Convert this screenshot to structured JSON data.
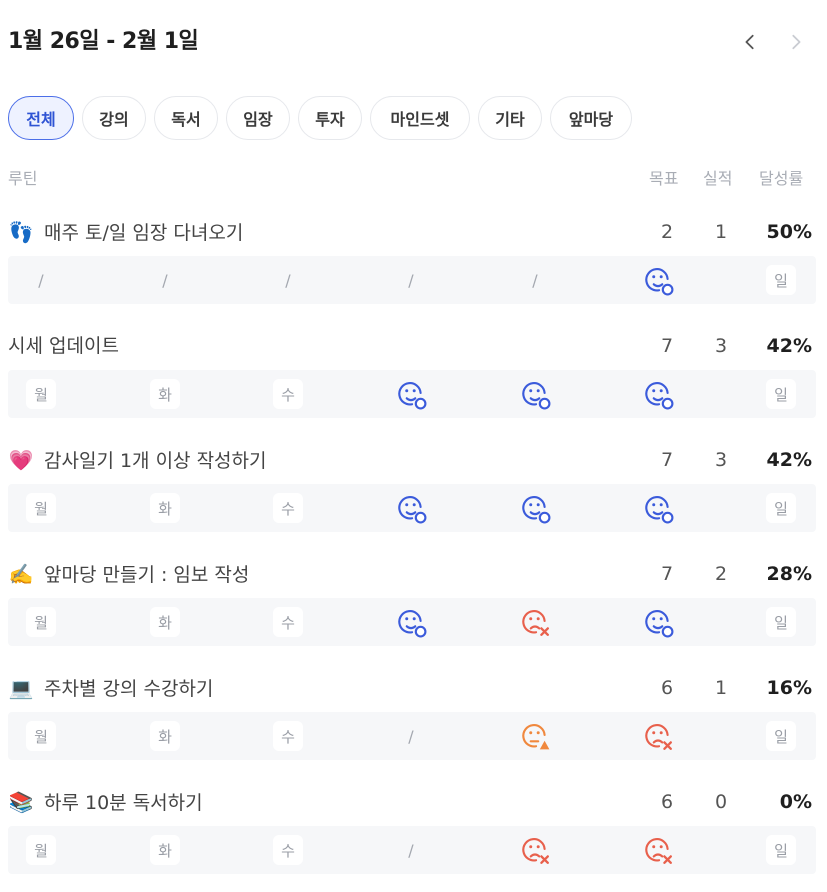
{
  "header": {
    "title": "1월 26일 - 2월 1일"
  },
  "categories": [
    {
      "label": "전체",
      "active": true
    },
    {
      "label": "강의",
      "active": false
    },
    {
      "label": "독서",
      "active": false
    },
    {
      "label": "임장",
      "active": false
    },
    {
      "label": "투자",
      "active": false
    },
    {
      "label": "마인드셋",
      "active": false
    },
    {
      "label": "기타",
      "active": false
    },
    {
      "label": "앞마당",
      "active": false
    }
  ],
  "columns": {
    "routine": "루틴",
    "goal": "목표",
    "actual": "실적",
    "rate": "달성률"
  },
  "colors": {
    "success": "#3b5bdb",
    "fail": "#e8604c",
    "warning": "#f0883e",
    "accent": "#2f54d4"
  },
  "routines": [
    {
      "emoji": "👣",
      "name": "매주 토/일 임장 다녀오기",
      "goal": "2",
      "actual": "1",
      "rate": "50%",
      "days": [
        {
          "type": "slash",
          "text": "/"
        },
        {
          "type": "slash",
          "text": "/"
        },
        {
          "type": "slash",
          "text": "/"
        },
        {
          "type": "slash",
          "text": "/"
        },
        {
          "type": "slash",
          "text": "/"
        },
        {
          "type": "success",
          "icon": "smile-check-icon"
        },
        {
          "type": "label",
          "text": "일"
        }
      ]
    },
    {
      "emoji": "",
      "name": "시세 업데이트",
      "goal": "7",
      "actual": "3",
      "rate": "42%",
      "days": [
        {
          "type": "label",
          "text": "월"
        },
        {
          "type": "label",
          "text": "화"
        },
        {
          "type": "label",
          "text": "수"
        },
        {
          "type": "success",
          "icon": "smile-check-icon"
        },
        {
          "type": "success",
          "icon": "smile-check-icon"
        },
        {
          "type": "success",
          "icon": "smile-check-icon"
        },
        {
          "type": "label",
          "text": "일"
        }
      ]
    },
    {
      "emoji": "💗",
      "name": "감사일기 1개 이상 작성하기",
      "goal": "7",
      "actual": "3",
      "rate": "42%",
      "days": [
        {
          "type": "label",
          "text": "월"
        },
        {
          "type": "label",
          "text": "화"
        },
        {
          "type": "label",
          "text": "수"
        },
        {
          "type": "success",
          "icon": "smile-check-icon"
        },
        {
          "type": "success",
          "icon": "smile-check-icon"
        },
        {
          "type": "success",
          "icon": "smile-check-icon"
        },
        {
          "type": "label",
          "text": "일"
        }
      ]
    },
    {
      "emoji": "✍️",
      "name": "앞마당 만들기 : 임보 작성",
      "goal": "7",
      "actual": "2",
      "rate": "28%",
      "days": [
        {
          "type": "label",
          "text": "월"
        },
        {
          "type": "label",
          "text": "화"
        },
        {
          "type": "label",
          "text": "수"
        },
        {
          "type": "success",
          "icon": "smile-check-icon"
        },
        {
          "type": "fail",
          "icon": "sad-x-icon"
        },
        {
          "type": "success",
          "icon": "smile-check-icon"
        },
        {
          "type": "label",
          "text": "일"
        }
      ]
    },
    {
      "emoji": "💻",
      "name": "주차별 강의 수강하기",
      "goal": "6",
      "actual": "1",
      "rate": "16%",
      "days": [
        {
          "type": "label",
          "text": "월"
        },
        {
          "type": "label",
          "text": "화"
        },
        {
          "type": "label",
          "text": "수"
        },
        {
          "type": "slash",
          "text": "/"
        },
        {
          "type": "warning",
          "icon": "meh-warning-icon"
        },
        {
          "type": "fail",
          "icon": "sad-x-icon"
        },
        {
          "type": "label",
          "text": "일"
        }
      ]
    },
    {
      "emoji": "📚",
      "name": "하루 10분 독서하기",
      "goal": "6",
      "actual": "0",
      "rate": "0%",
      "days": [
        {
          "type": "label",
          "text": "월"
        },
        {
          "type": "label",
          "text": "화"
        },
        {
          "type": "label",
          "text": "수"
        },
        {
          "type": "slash",
          "text": "/"
        },
        {
          "type": "fail",
          "icon": "sad-x-icon"
        },
        {
          "type": "fail",
          "icon": "sad-x-icon"
        },
        {
          "type": "label",
          "text": "일"
        }
      ]
    }
  ]
}
